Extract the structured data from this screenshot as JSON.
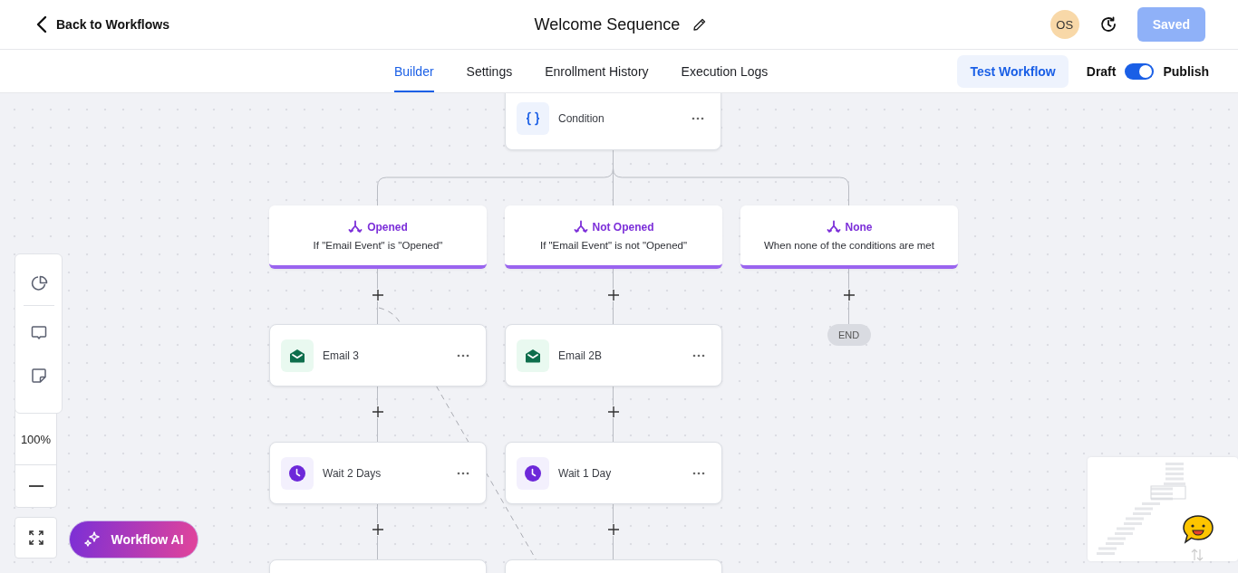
{
  "header": {
    "back_label": "Back to Workflows",
    "title": "Welcome Sequence",
    "avatar": "OS",
    "save_button": {
      "label": "Saved",
      "disabled": true
    }
  },
  "tabs": [
    {
      "label": "Builder",
      "selected": true
    },
    {
      "label": "Settings",
      "selected": false
    },
    {
      "label": "Enrollment History",
      "selected": false
    },
    {
      "label": "Execution Logs",
      "selected": false
    }
  ],
  "test_button": {
    "label": "Test Workflow"
  },
  "publish_toggle": {
    "off_label": "Draft",
    "on_label": "Publish",
    "on": true
  },
  "flow": {
    "condition": {
      "label": "Condition"
    },
    "branches": [
      {
        "label": "Opened",
        "description": "If \"Email Event\" is \"Opened\"",
        "steps": [
          {
            "kind": "email",
            "label": "Email 3"
          },
          {
            "kind": "wait",
            "label": "Wait 2 Days"
          },
          {
            "kind": "cut_off"
          }
        ]
      },
      {
        "label": "Not Opened",
        "description": "If \"Email Event\" is not \"Opened\"",
        "steps": [
          {
            "kind": "email",
            "label": "Email 2B"
          },
          {
            "kind": "wait",
            "label": "Wait 1 Day"
          },
          {
            "kind": "cut_off"
          }
        ]
      },
      {
        "label": "None",
        "description": "When none of the conditions are met",
        "end_label": "END"
      }
    ]
  },
  "zoom": {
    "level_text": "100%"
  },
  "ai_button": {
    "label": "Workflow AI"
  }
}
